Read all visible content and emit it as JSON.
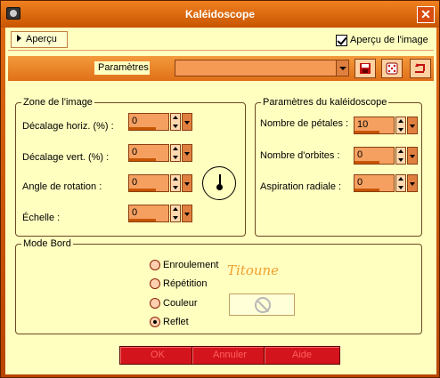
{
  "window": {
    "title": "Kaléidoscope",
    "close_glyph": "✕"
  },
  "preview": {
    "apercu_label": "Aperçu",
    "apercu_image_label": "Aperçu de l'image",
    "apercu_image_checked": true
  },
  "params": {
    "label": "Paramètres",
    "selected": "",
    "buttons": [
      "save-icon",
      "random-dice-icon",
      "reset-icon"
    ]
  },
  "zone": {
    "title": "Zone de l'image",
    "fields": [
      {
        "label": "Décalage horiz. (%) :",
        "value": "0"
      },
      {
        "label": "Décalage vert. (%) :",
        "value": "0"
      },
      {
        "label": "Angle de rotation :",
        "value": "0"
      },
      {
        "label": "Échelle :",
        "value": "0"
      }
    ]
  },
  "kaleido": {
    "title": "Paramètres du kaléidoscope",
    "fields": [
      {
        "label": "Nombre de pétales :",
        "value": "10"
      },
      {
        "label": "Nombre d'orbites :",
        "value": "0"
      },
      {
        "label": "Aspiration radiale :",
        "value": "0"
      }
    ]
  },
  "bord": {
    "title": "Mode Bord",
    "options": [
      "Enroulement",
      "Répétition",
      "Couleur",
      "Reflet"
    ],
    "selected": "Reflet",
    "signature": "Titoune"
  },
  "buttons": {
    "ok": "OK",
    "cancel": "Annuler",
    "help": "Aide"
  },
  "colors": {
    "accent": "#e07018",
    "panel": "#ffffc0",
    "button_red": "#d4141c"
  }
}
